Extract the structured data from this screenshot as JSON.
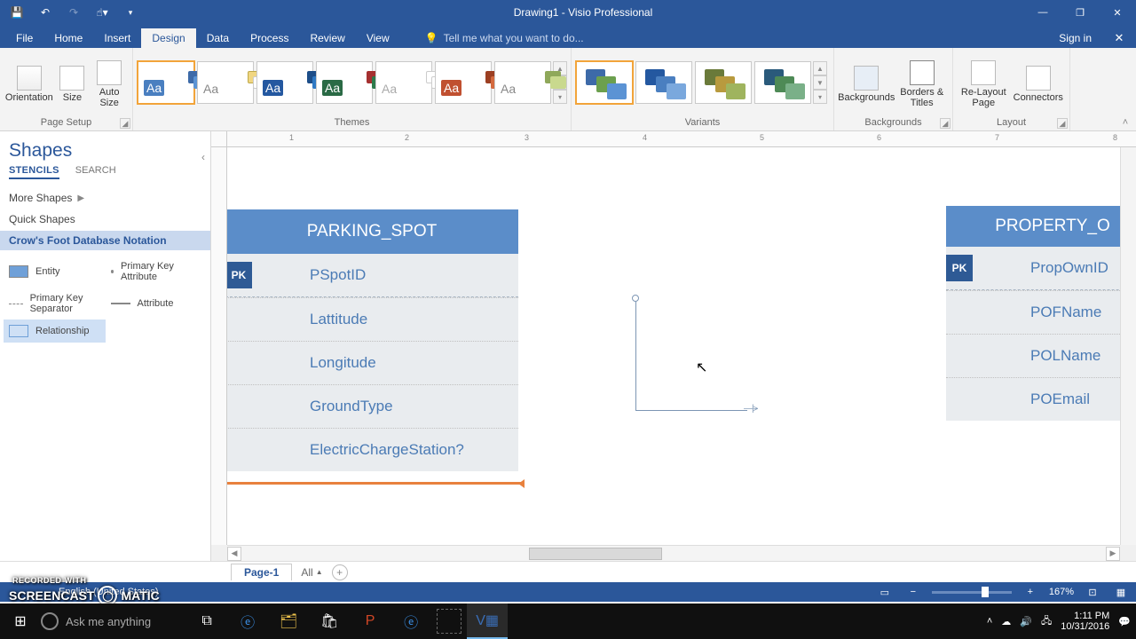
{
  "title": "Drawing1 - Visio Professional",
  "tabs": {
    "file": "File",
    "home": "Home",
    "insert": "Insert",
    "design": "Design",
    "data": "Data",
    "process": "Process",
    "review": "Review",
    "view": "View",
    "tellme": "Tell me what you want to do...",
    "signin": "Sign in"
  },
  "ribbon": {
    "page_setup": {
      "label": "Page Setup",
      "orientation": "Orientation",
      "size": "Size",
      "autosize": "Auto Size"
    },
    "themes": {
      "label": "Themes"
    },
    "variants": {
      "label": "Variants"
    },
    "backgrounds": {
      "label": "Backgrounds",
      "bg": "Backgrounds",
      "borders": "Borders & Titles"
    },
    "layout": {
      "label": "Layout",
      "relayout": "Re-Layout Page",
      "connectors": "Connectors"
    }
  },
  "shapes_panel": {
    "title": "Shapes",
    "stencils": "STENCILS",
    "search": "SEARCH",
    "more": "More Shapes",
    "quick": "Quick Shapes",
    "stencil_name": "Crow's Foot Database Notation",
    "items": {
      "entity": "Entity",
      "pk_attr": "Primary Key Attribute",
      "pk_sep": "Primary Key Separator",
      "attribute": "Attribute",
      "relationship": "Relationship"
    }
  },
  "canvas": {
    "entity1": {
      "title": "PARKING_SPOT",
      "pk": "PK",
      "attrs": [
        "PSpotID",
        "Lattitude",
        "Longitude",
        "GroundType",
        "ElectricChargeStation?"
      ]
    },
    "entity2": {
      "title": "PROPERTY_O",
      "pk": "PK",
      "attrs": [
        "PropOwnID",
        "POFName",
        "POLName",
        "POEmail"
      ]
    }
  },
  "pagetabs": {
    "page1": "Page-1",
    "all": "All",
    "add": "+"
  },
  "statusbar": {
    "lang": "English (United States)",
    "zoom": "167%"
  },
  "taskbar": {
    "search": "Ask me anything",
    "time": "1:11 PM",
    "date": "10/31/2016"
  },
  "watermark": {
    "rec": "RECORDED WITH",
    "text1": "SCREENCAST",
    "text2": "MATIC"
  }
}
